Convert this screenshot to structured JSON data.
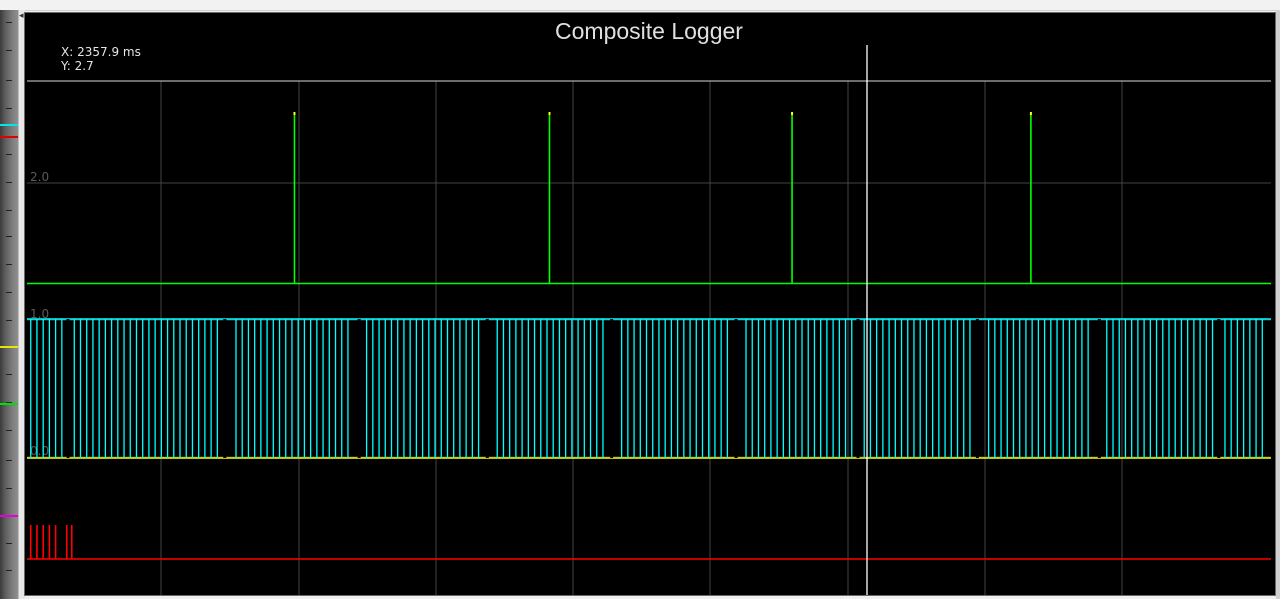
{
  "window": {
    "bg": "#000000"
  },
  "readout": {
    "x_label": "X:",
    "x_value": "2357.9 ms",
    "y_label": "Y:",
    "y_value": "2.7"
  },
  "colors": {
    "trigger": "#00ff00",
    "teeth": "#00ffff",
    "sync": "#ffff00",
    "event": "#ff0000",
    "grid": "#444444",
    "cursor": "#ffffff",
    "title": "#e0e0e0",
    "ytick": "#5a5a5a"
  },
  "left_panel": {
    "swatches": [
      {
        "color": "#00e5e5"
      },
      {
        "color": "#e00000"
      },
      {
        "color": "#e5e500"
      },
      {
        "color": "#00e000"
      },
      {
        "color": "#e000e0"
      }
    ]
  },
  "chart_data": {
    "type": "line",
    "title": "Composite Logger",
    "xlabel": "",
    "ylabel": "",
    "ylim": [
      -0.8,
      3.0
    ],
    "y_ticks": [
      {
        "value": 2.0,
        "label": "2.0"
      },
      {
        "value": 1.0,
        "label": "1.0"
      },
      {
        "value": 0.0,
        "label": "0.0"
      }
    ],
    "grid": true,
    "cursor": {
      "x": 2357.9,
      "y": 2.7
    },
    "series": [
      {
        "key": "trigger",
        "baseline": 1.5,
        "pulse_top": 2.5,
        "pulses": [
          0.215,
          0.42,
          0.615,
          0.807
        ]
      },
      {
        "key": "teeth",
        "high": 1.0,
        "low": 0.0,
        "pulse_period_fraction": 0.005,
        "gaps": [
          0.033,
          0.159,
          0.267,
          0.37,
          0.47,
          0.57,
          0.668,
          0.764,
          0.862,
          0.958
        ]
      },
      {
        "key": "event",
        "baseline": -0.75,
        "pulse_top": -0.5,
        "pulses": [
          0.003,
          0.008,
          0.013,
          0.018,
          0.023,
          0.032,
          0.036
        ]
      }
    ]
  }
}
